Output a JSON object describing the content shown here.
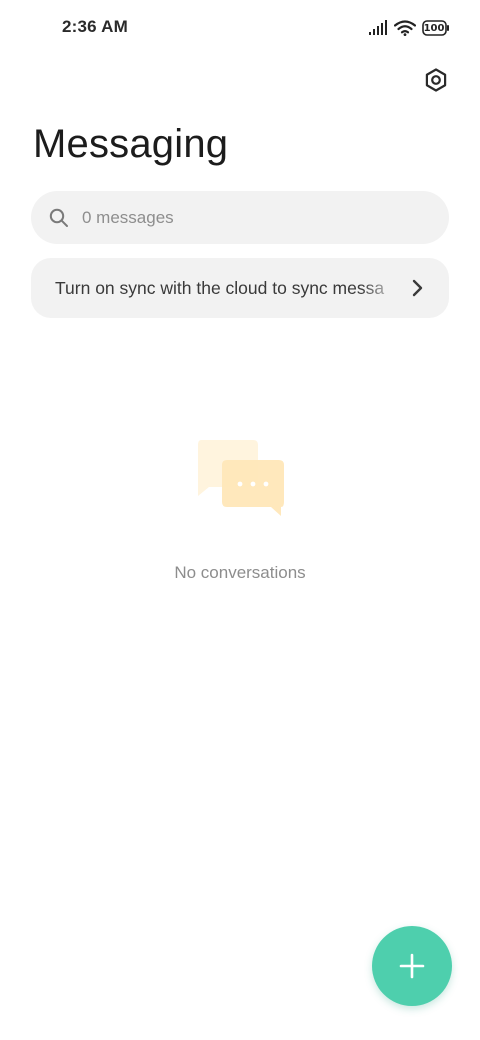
{
  "status_bar": {
    "time": "2:36 AM",
    "battery": "100",
    "icons": [
      "signal-icon",
      "wifi-icon",
      "battery-icon"
    ]
  },
  "header": {
    "title": "Messaging",
    "settings_icon": "gear-icon"
  },
  "search": {
    "placeholder": "0 messages",
    "value": "",
    "icon": "search-icon"
  },
  "sync_banner": {
    "text": "Turn on sync with the cloud to sync messa",
    "icon": "chevron-right-icon"
  },
  "empty_state": {
    "icon": "chat-bubbles-icon",
    "text": "No conversations"
  },
  "fab": {
    "icon": "plus-icon"
  },
  "colors": {
    "accent": "#4ecfad",
    "surface": "#f2f2f2",
    "illustration": "#ffe7b8"
  }
}
